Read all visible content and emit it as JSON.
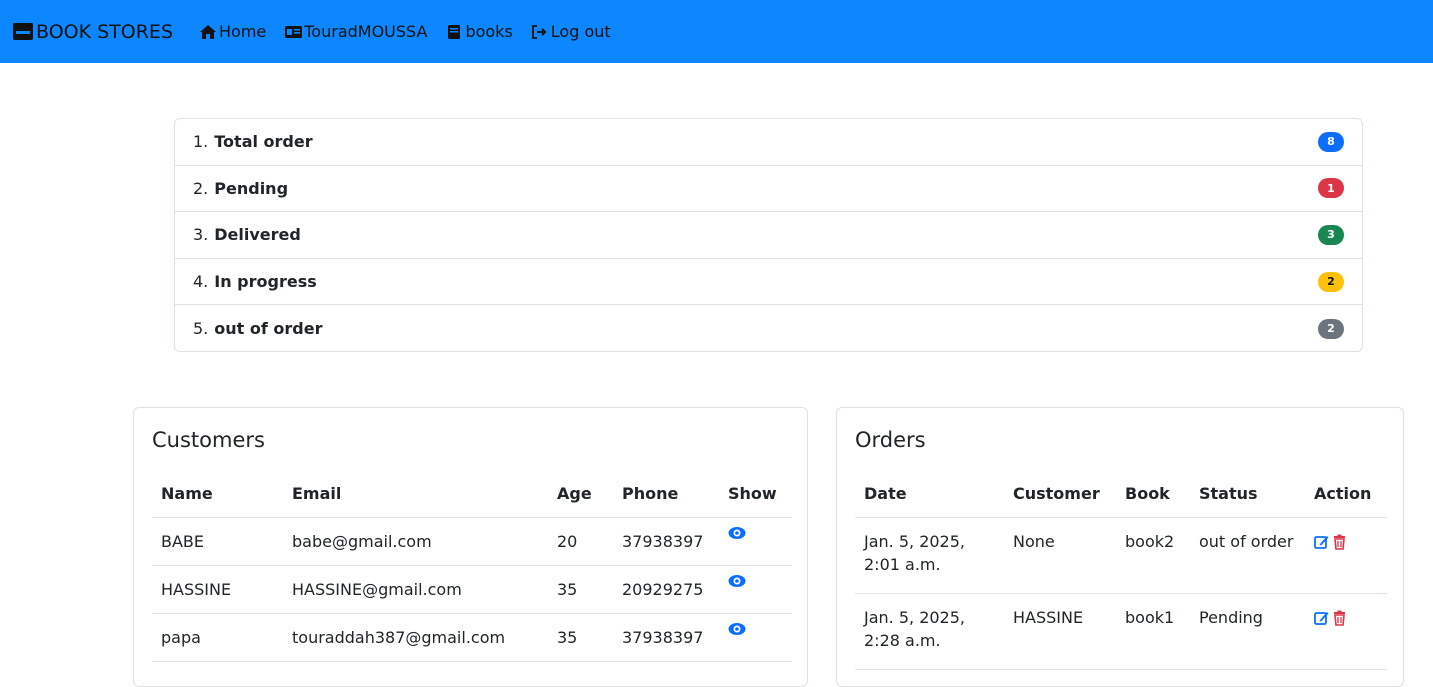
{
  "navbar": {
    "brand": "BOOK STORES",
    "links": [
      {
        "label": "Home",
        "icon": "home-icon"
      },
      {
        "label": "TouradMOUSSA",
        "icon": "id-card-icon"
      },
      {
        "label": "books",
        "icon": "book-icon"
      },
      {
        "label": "Log out",
        "icon": "logout-icon"
      }
    ],
    "background": "#0d87ff"
  },
  "status_list": [
    {
      "num": "1.",
      "label": "Total order",
      "count": "8",
      "color": "#0d6efd"
    },
    {
      "num": "2.",
      "label": "Pending",
      "count": "1",
      "color": "#dc3545"
    },
    {
      "num": "3.",
      "label": "Delivered",
      "count": "3",
      "color": "#198754"
    },
    {
      "num": "4.",
      "label": "In progress",
      "count": "2",
      "color": "#ffc107"
    },
    {
      "num": "5.",
      "label": "out of order",
      "count": "2",
      "color": "#6c757d"
    }
  ],
  "customers": {
    "title": "Customers",
    "headers": [
      "Name",
      "Email",
      "Age",
      "Phone",
      "Show"
    ],
    "rows": [
      {
        "name": "BABE",
        "email": "babe@gmail.com",
        "age": "20",
        "phone": "37938397"
      },
      {
        "name": "HASSINE",
        "email": "HASSINE@gmail.com",
        "age": "35",
        "phone": "20929275"
      },
      {
        "name": "papa",
        "email": "touraddah387@gmail.com",
        "age": "35",
        "phone": "37938397"
      }
    ]
  },
  "orders": {
    "title": "Orders",
    "headers": [
      "Date",
      "Customer",
      "Book",
      "Status",
      "Action"
    ],
    "rows": [
      {
        "date": "Jan. 5, 2025, 2:01 a.m.",
        "customer": "None",
        "book": "book2",
        "status": "out of order"
      },
      {
        "date": "Jan. 5, 2025, 2:28 a.m.",
        "customer": "HASSINE",
        "book": "book1",
        "status": "Pending"
      }
    ]
  }
}
